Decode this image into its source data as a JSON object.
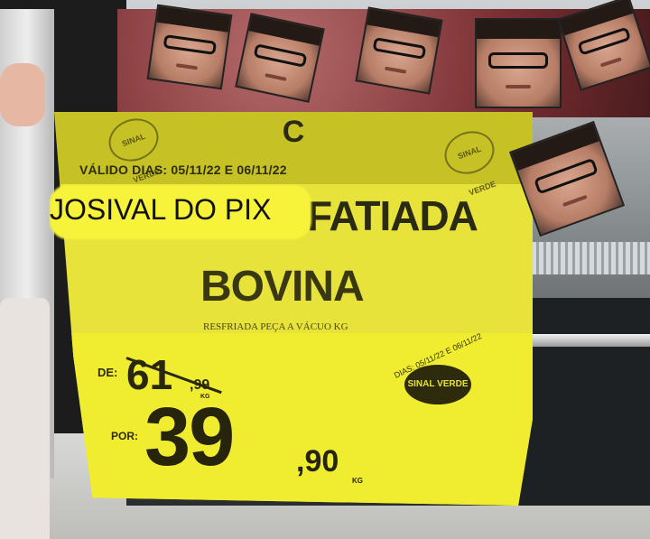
{
  "sign": {
    "top_brand_glyph": "C",
    "valid_text": "VÁLIDO DIAS: 05/11/22 E 06/11/22",
    "product_line1": "FATIADA",
    "product_line2": "BOVINA",
    "subtitle": "RESFRIADA PEÇA A VÁCUO KG",
    "de_label": "DE:",
    "old_price_main": "61",
    "old_price_cents": ",99",
    "old_price_unit": "KG",
    "por_label": "POR:",
    "new_price_main": "39",
    "new_price_cents": ",90",
    "new_price_unit": "KG",
    "seal_text": "DIAS: 05/11/22 E 06/11/22",
    "seal_center": "SINAL VERDE",
    "small_seal_left": "SINAL VERDE",
    "small_seal_right": "SINAL VERDE"
  },
  "overlay": {
    "caption": "JOSIVAL DO PIX"
  },
  "faces": [
    {
      "icon": "face-sticker"
    },
    {
      "icon": "face-sticker"
    },
    {
      "icon": "face-sticker"
    },
    {
      "icon": "face-sticker"
    },
    {
      "icon": "face-sticker"
    },
    {
      "icon": "face-sticker"
    }
  ],
  "colors": {
    "sign_yellow": "#e7e33a",
    "sign_top": "#c6c125",
    "highlight": "#f6f33a",
    "ink": "#2b2a12"
  }
}
